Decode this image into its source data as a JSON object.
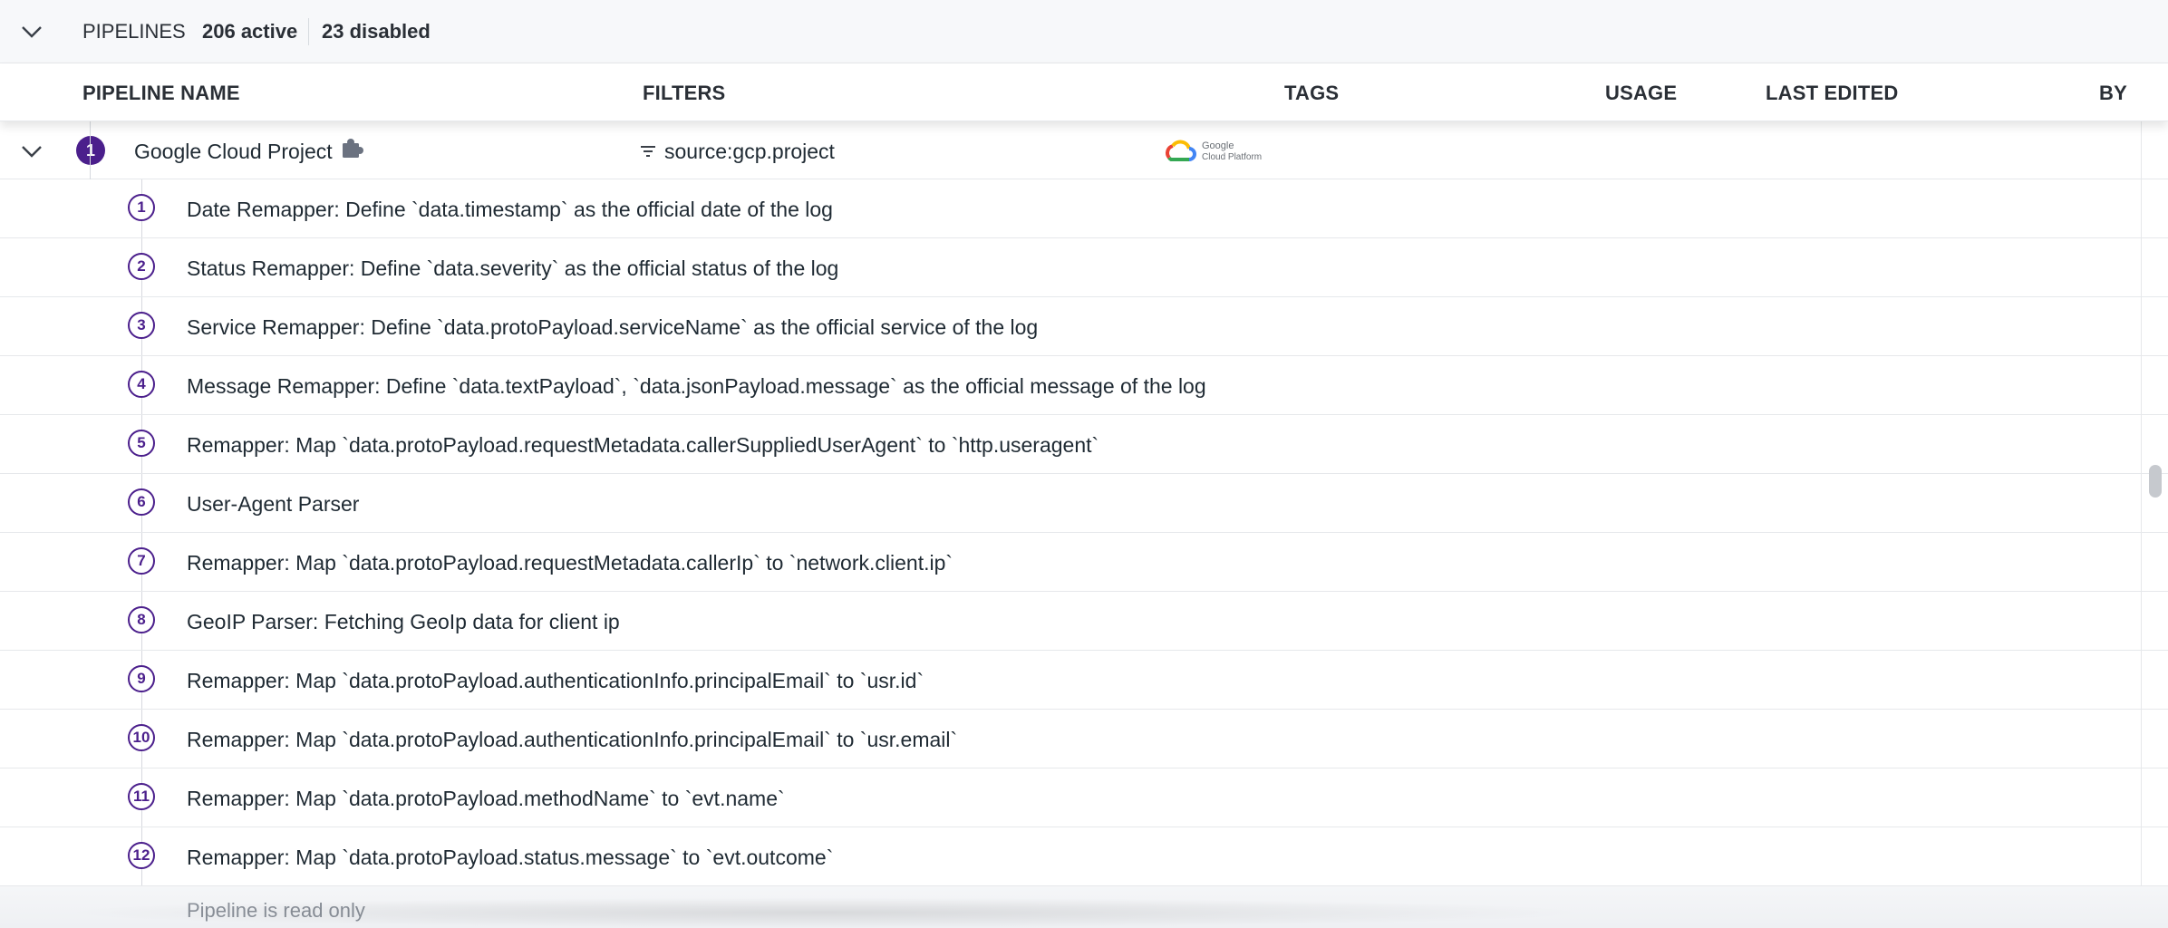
{
  "summary": {
    "label": "PIPELINES",
    "active": "206 active",
    "disabled": "23 disabled"
  },
  "columns": {
    "pipeline_name": "PIPELINE NAME",
    "filters": "FILTERS",
    "tags": "TAGS",
    "usage": "USAGE",
    "last_edited": "LAST EDITED",
    "by": "BY"
  },
  "pipeline": {
    "index": "1",
    "name": "Google Cloud Project",
    "filter": "source:gcp.project",
    "tag_logo_line1": "Google",
    "tag_logo_line2": "Cloud Platform"
  },
  "processors": [
    {
      "num": "1",
      "text": "Date Remapper: Define `data.timestamp` as the official date of the log"
    },
    {
      "num": "2",
      "text": "Status Remapper: Define `data.severity` as the official status of the log"
    },
    {
      "num": "3",
      "text": "Service Remapper: Define `data.protoPayload.serviceName` as the official service of the log"
    },
    {
      "num": "4",
      "text": "Message Remapper: Define `data.textPayload`, `data.jsonPayload.message` as the official message of the log"
    },
    {
      "num": "5",
      "text": "Remapper: Map `data.protoPayload.requestMetadata.callerSuppliedUserAgent` to `http.useragent`"
    },
    {
      "num": "6",
      "text": "User-Agent Parser"
    },
    {
      "num": "7",
      "text": "Remapper: Map `data.protoPayload.requestMetadata.callerIp` to `network.client.ip`"
    },
    {
      "num": "8",
      "text": "GeoIP Parser: Fetching GeoIp data for client ip"
    },
    {
      "num": "9",
      "text": "Remapper: Map `data.protoPayload.authenticationInfo.principalEmail` to `usr.id`"
    },
    {
      "num": "10",
      "text": "Remapper: Map `data.protoPayload.authenticationInfo.principalEmail` to `usr.email`"
    },
    {
      "num": "11",
      "text": "Remapper: Map `data.protoPayload.methodName` to `evt.name`"
    },
    {
      "num": "12",
      "text": "Remapper: Map `data.protoPayload.status.message` to `evt.outcome`"
    }
  ],
  "readonly_note": "Pipeline is read only",
  "colors": {
    "accent": "#4b1f8c",
    "text": "#1f2a33",
    "border": "#e6e8eb"
  },
  "icons": {
    "collapse": "chevron-down-icon",
    "integration": "puzzle-icon",
    "filter": "filter-icon",
    "tag": "google-cloud-logo"
  }
}
